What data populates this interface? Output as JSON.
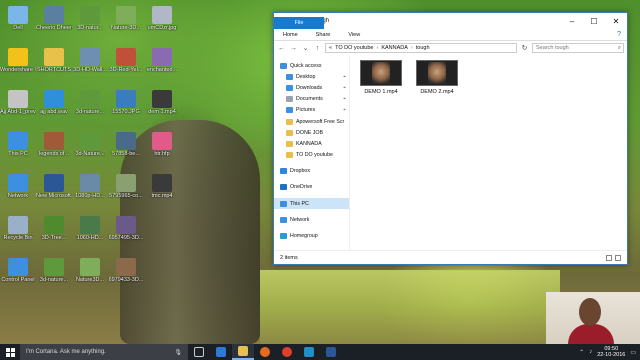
{
  "desktop": {
    "icons": [
      {
        "label": "Dell",
        "color": "#7ab6e8"
      },
      {
        "label": "Cheerio Dheere Sa",
        "color": "#5a7fa0"
      },
      {
        "label": "3D-natur...",
        "color": "#5e9a3c"
      },
      {
        "label": "Nature-3D...",
        "color": "#7fae5a"
      },
      {
        "label": "umCDzr.jpg",
        "color": "#b0b8c8"
      },
      {
        "label": "Wondershare Video Editor",
        "color": "#f2c21b"
      },
      {
        "label": "SHORTCUTS",
        "color": "#e8c14a"
      },
      {
        "label": "3D-HD-Wall...",
        "color": "#6e8fb0"
      },
      {
        "label": "3D-Red-Yel...",
        "color": "#c0503a"
      },
      {
        "label": "enchanted...",
        "color": "#8a6ab0"
      },
      {
        "label": "Ajj Abd-1_prev...",
        "color": "#c4c4c4"
      },
      {
        "label": "ajj abd.wav",
        "color": "#2f8fd8"
      },
      {
        "label": "3d-nature...",
        "color": "#5e9a3c"
      },
      {
        "label": "15570.JPG",
        "color": "#3a7cc0"
      },
      {
        "label": "dem 1.mp4",
        "color": "#3a3a3a"
      },
      {
        "label": "This PC",
        "color": "#3d8fe0"
      },
      {
        "label": "legends of...",
        "color": "#a05a3a"
      },
      {
        "label": "3d-Nature...",
        "color": "#5e9a3c"
      },
      {
        "label": "57858-be...",
        "color": "#4a6a8a"
      },
      {
        "label": "htr.hfp",
        "color": "#e05a8a"
      },
      {
        "label": "Network",
        "color": "#3d8fe0"
      },
      {
        "label": "New Microsoft...",
        "color": "#2b5797"
      },
      {
        "label": "1080p-HD...",
        "color": "#6a8aa8"
      },
      {
        "label": "5795965-co...",
        "color": "#8aa070"
      },
      {
        "label": "tmc.mp4",
        "color": "#3a3a3a"
      },
      {
        "label": "Recycle Bin",
        "color": "#9ab0c8"
      },
      {
        "label": "3D-Tree...",
        "color": "#4f8a2f"
      },
      {
        "label": "1060-HD...",
        "color": "#4a7a4a"
      },
      {
        "label": "6957495-3D...",
        "color": "#6a5a8a"
      },
      {
        "label": "",
        "color": "#000000"
      },
      {
        "label": "Control Panel",
        "color": "#3d8fe0"
      },
      {
        "label": "3d-nature...",
        "color": "#5e9a3c"
      },
      {
        "label": "Nature3D...",
        "color": "#7fae5a"
      },
      {
        "label": "6979433-3D...",
        "color": "#8a6a4a"
      },
      {
        "label": "",
        "color": "#000000"
      }
    ]
  },
  "explorer": {
    "window_title": "tough",
    "ribbon_tabs": [
      "File",
      "Home",
      "Share",
      "View"
    ],
    "address": {
      "overflow": "«",
      "parts": [
        "TO DO youtube",
        "KANNADA",
        "tough"
      ],
      "separator": "›"
    },
    "search_placeholder": "Search tough",
    "nav_pane": {
      "quick_access": "Quick access",
      "qa_items": [
        "Desktop",
        "Downloads",
        "Documents",
        "Pictures",
        "Apowersoft Free Scr",
        "DONE JOB",
        "KANNADA",
        "TO DO youtube"
      ],
      "dropbox": "Dropbox",
      "onedrive": "OneDrive",
      "this_pc": "This PC",
      "network": "Network",
      "homegroup": "Homegroup"
    },
    "files": [
      {
        "name": "DEMO 1.mp4"
      },
      {
        "name": "DEMO 2.mp4"
      }
    ],
    "status": "2 items"
  },
  "taskbar": {
    "cortana_text": "I'm Cortana. Ask me anything.",
    "time": "09:50",
    "date": "22-10-2016"
  }
}
